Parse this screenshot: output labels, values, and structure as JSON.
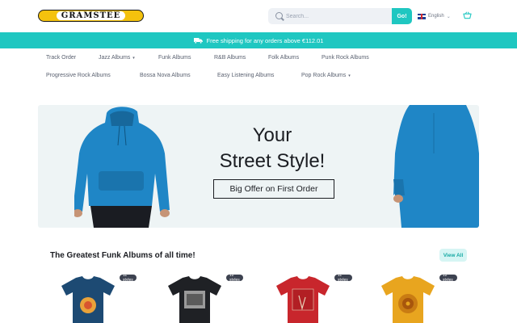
{
  "header": {
    "logo_text": "GRAMSTEE",
    "search": {
      "placeholder": "Search...",
      "value": ""
    },
    "go_label": "Go!",
    "language": "English"
  },
  "promo": {
    "text": "Free shipping for any orders above €112.01"
  },
  "nav": {
    "row1": [
      {
        "label": "Track Order",
        "dropdown": false
      },
      {
        "label": "Jazz Albums",
        "dropdown": true
      },
      {
        "label": "Funk Albums",
        "dropdown": false
      },
      {
        "label": "R&B Albums",
        "dropdown": false
      },
      {
        "label": "Folk Albums",
        "dropdown": false
      },
      {
        "label": "Punk Rock Albums",
        "dropdown": false
      }
    ],
    "row2": [
      {
        "label": "Progressive Rock Albums",
        "dropdown": false
      },
      {
        "label": "Bossa Nova Albums",
        "dropdown": false
      },
      {
        "label": "Easy Listening Albums",
        "dropdown": false
      },
      {
        "label": "Pop Rock Albums",
        "dropdown": true
      }
    ]
  },
  "hero": {
    "line1": "Your",
    "line2": "Street Style!",
    "button": "Big Offer on First Order",
    "hoodie_color": "#1f86c6"
  },
  "section": {
    "title": "The Greatest Funk Albums of all time!",
    "view_all": "View All"
  },
  "products": [
    {
      "badge": "11 styles",
      "color": "#1d4a73"
    },
    {
      "badge": "12 styles",
      "color": "#1f2125"
    },
    {
      "badge": "11 styles",
      "color": "#c8262c"
    },
    {
      "badge": "12 styles",
      "color": "#e8a51f"
    }
  ],
  "colors": {
    "accent": "#1fc7c1",
    "logo_yellow": "#f4c20d"
  }
}
